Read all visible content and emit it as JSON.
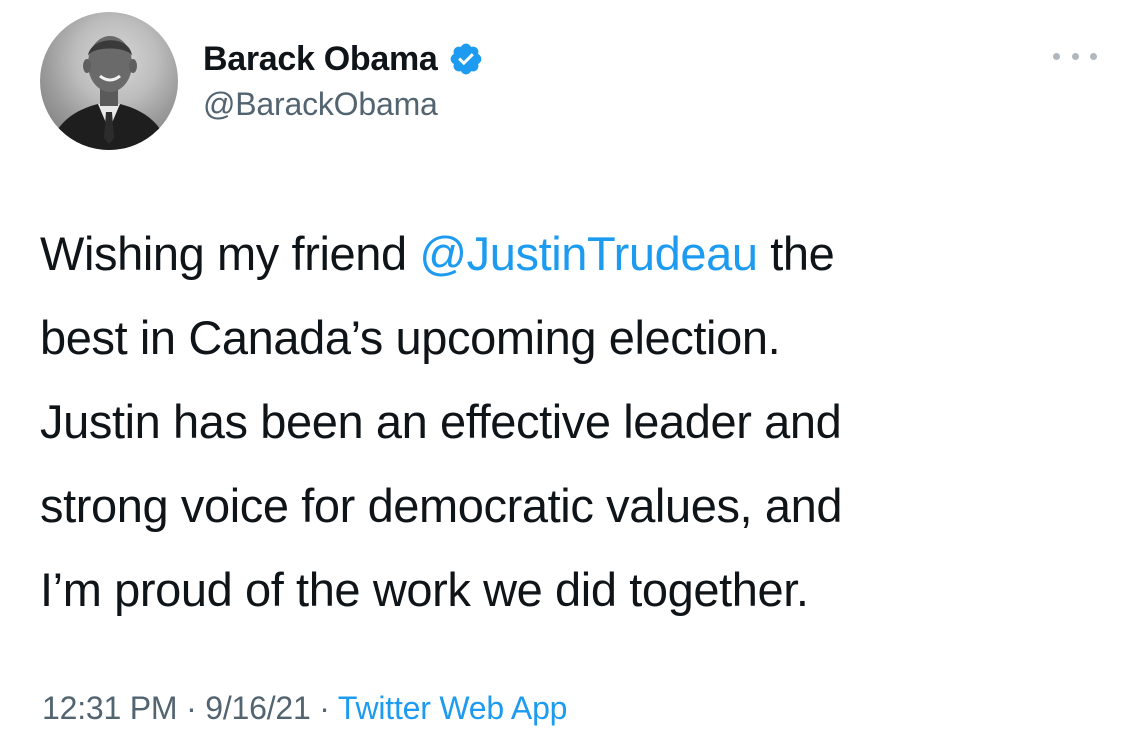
{
  "author": {
    "display_name": "Barack Obama",
    "handle": "@BarackObama",
    "verified": true,
    "avatar_icon": "profile-photo"
  },
  "menu": {
    "icon": "more-options-icon"
  },
  "tweet": {
    "line1_pre": "Wishing my friend ",
    "mention": "@JustinTrudeau",
    "line1_post": " the",
    "line2": "best in Canada’s upcoming election.",
    "line3": "Justin has been an effective leader and",
    "line4": "strong voice for democratic values, and",
    "line5": "I’m proud of the work we did together."
  },
  "meta": {
    "time": "12:31 PM",
    "sep1": " · ",
    "date": "9/16/21",
    "sep2": " · ",
    "source": "Twitter Web App"
  },
  "colors": {
    "link": "#1d9bf0",
    "secondary_text": "#536471",
    "primary_text": "#0f1419",
    "verified_badge": "#1d9bf0"
  }
}
